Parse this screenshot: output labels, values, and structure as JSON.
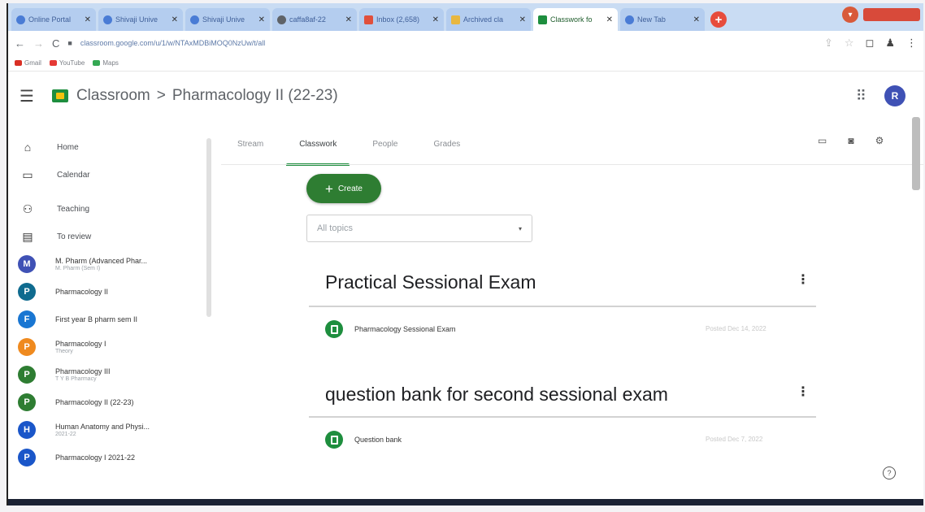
{
  "browser": {
    "tabs": [
      {
        "title": "Online Portal",
        "fav": "b",
        "active": false
      },
      {
        "title": "Shivaji Unive",
        "fav": "b",
        "active": false
      },
      {
        "title": "Shivaji Unive",
        "fav": "b",
        "active": false
      },
      {
        "title": "caffa8af-22",
        "fav": "",
        "active": false
      },
      {
        "title": "Inbox (2,658)",
        "fav": "m",
        "active": false
      },
      {
        "title": "Archived cla",
        "fav": "",
        "active": false
      },
      {
        "title": "Classwork fo",
        "fav": "g",
        "active": true
      },
      {
        "title": "New Tab",
        "fav": "b",
        "active": false
      }
    ],
    "url": "classroom.google.com/u/1/w/NTAxMDBiMOQ0NzUw/t/all",
    "bookmarks": [
      {
        "label": "Gmail",
        "color": "#d93025"
      },
      {
        "label": "YouTube",
        "color": "#e53935"
      },
      {
        "label": "Maps",
        "color": "#34a853"
      }
    ]
  },
  "header": {
    "app_name": "Classroom",
    "separator": ">",
    "class_name": "Pharmacology II (22-23)",
    "avatar_letter": "R"
  },
  "sidebar": {
    "home": "Home",
    "calendar": "Calendar",
    "teaching": "Teaching",
    "to_review": "To review",
    "classes": [
      {
        "letter": "M",
        "name": "M. Pharm (Advanced Phar...",
        "sub": "M. Pharm (Sem I)",
        "color": "#3f51b5"
      },
      {
        "letter": "P",
        "name": "Pharmacology II",
        "sub": "",
        "color": "#0f6b8f"
      },
      {
        "letter": "F",
        "name": "First year B pharm sem II",
        "sub": "",
        "color": "#1976d2"
      },
      {
        "letter": "P",
        "name": "Pharmacology I",
        "sub": "Theory",
        "color": "#ef8a1f"
      },
      {
        "letter": "P",
        "name": "Pharmacology III",
        "sub": "T Y B Pharmacy",
        "color": "#2e7d32"
      },
      {
        "letter": "P",
        "name": "Pharmacology II (22-23)",
        "sub": "",
        "color": "#2e7d32"
      },
      {
        "letter": "H",
        "name": "Human Anatomy and Physi...",
        "sub": "2021-22",
        "color": "#1a56c9"
      },
      {
        "letter": "P",
        "name": "Pharmacology I 2021-22",
        "sub": "",
        "color": "#1a56c9"
      }
    ]
  },
  "main": {
    "tabs": [
      "Stream",
      "Classwork",
      "People",
      "Grades"
    ],
    "create_label": "Create",
    "topics_placeholder": "All topics",
    "topics": [
      {
        "title": "Practical Sessional Exam",
        "item": "Pharmacology Sessional Exam",
        "posted": "Posted Dec 14, 2022"
      },
      {
        "title": "question bank for second sessional exam",
        "item": "Question bank",
        "posted": "Posted Dec 7, 2022"
      }
    ]
  }
}
